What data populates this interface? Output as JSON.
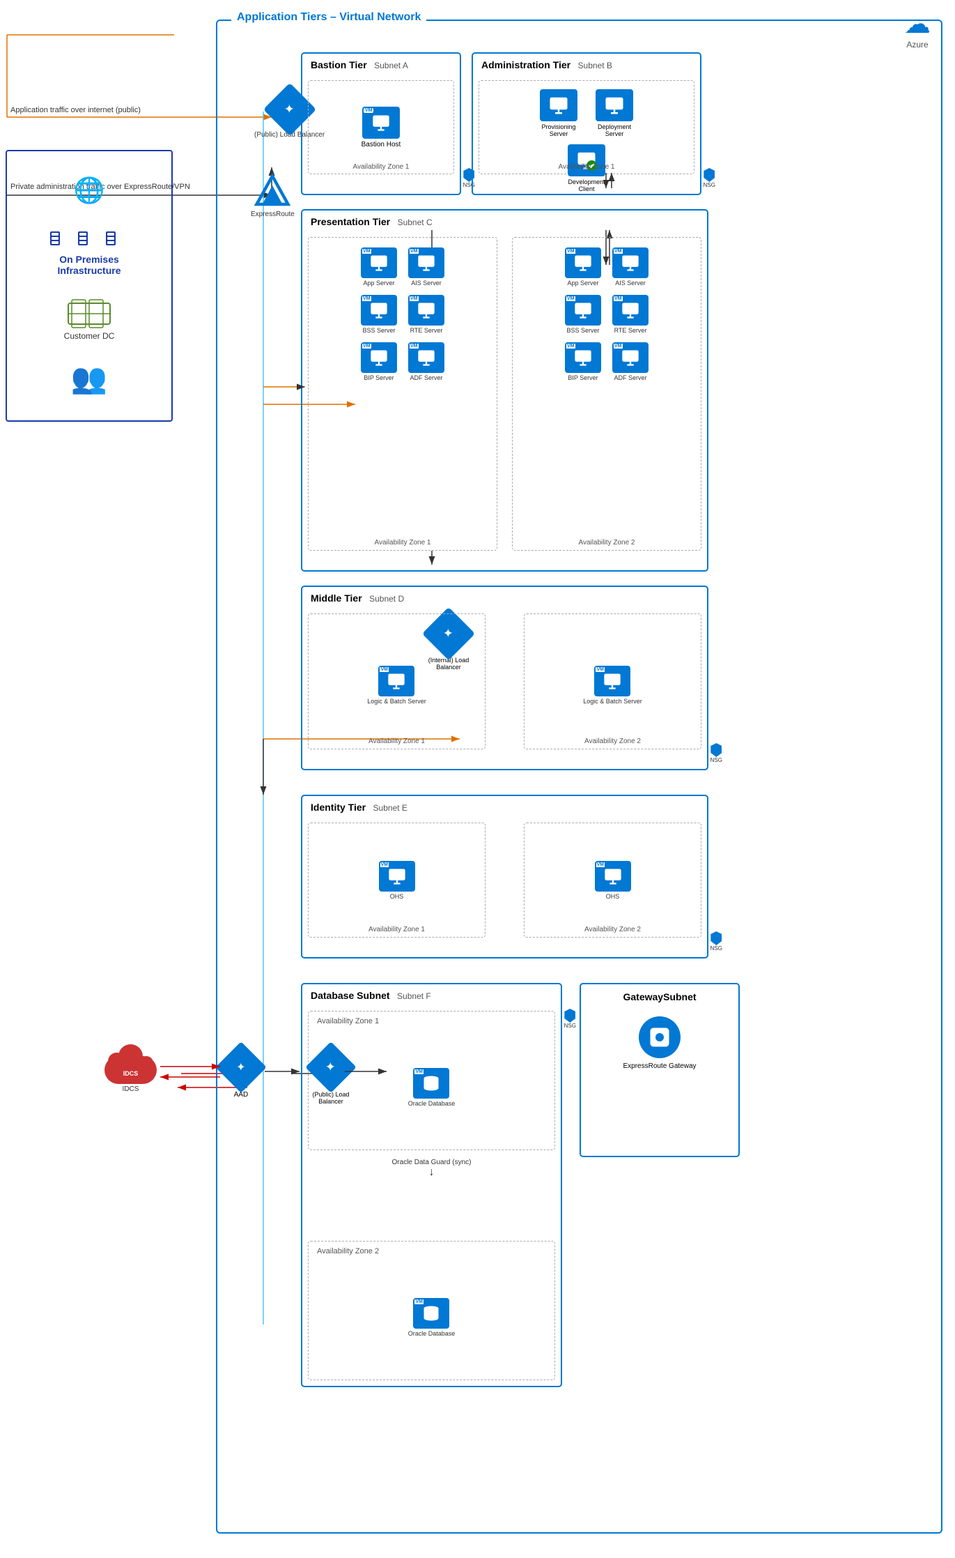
{
  "azure_label": "Azure",
  "vnet_title": "Application Tiers – Virtual Network",
  "on_prem": {
    "title": "On Premises\nInfrastructure",
    "customer_dc": "Customer DC"
  },
  "bastion_tier": {
    "title": "Bastion Tier",
    "subnet": "Subnet A",
    "bastion_host": "Bastion Host",
    "az_label": "Availability Zone 1"
  },
  "admin_tier": {
    "title": "Administration Tier",
    "subnet": "Subnet B",
    "provisioning_server": "Provisioning\nServer",
    "deployment_server": "Deployment\nServer",
    "development_client": "Development\nClient",
    "az_label": "Availability Zone 1"
  },
  "presentation_tier": {
    "title": "Presentation Tier",
    "subnet": "Subnet C",
    "az1_label": "Availability Zone 1",
    "az2_label": "Availability Zone 2",
    "servers_az1": [
      {
        "name": "App Server"
      },
      {
        "name": "AIS Server"
      },
      {
        "name": "BSS Server"
      },
      {
        "name": "RTE Server"
      },
      {
        "name": "BIP Server"
      },
      {
        "name": "ADF Server"
      }
    ],
    "servers_az2": [
      {
        "name": "App Server"
      },
      {
        "name": "AIS Server"
      },
      {
        "name": "BSS Server"
      },
      {
        "name": "RTE Server"
      },
      {
        "name": "BIP Server"
      },
      {
        "name": "ADF Server"
      }
    ]
  },
  "middle_tier": {
    "title": "Middle Tier",
    "subnet": "Subnet D",
    "lb_label": "(Internal)\nLoad Balancer",
    "az1_label": "Availability Zone 1",
    "az2_label": "Availability Zone 2",
    "server_az1": "Logic & Batch Server",
    "server_az2": "Logic & Batch Server"
  },
  "identity_tier": {
    "title": "Identity Tier",
    "subnet": "Subnet E",
    "lb_label": "(Public)\nLoad Balancer",
    "az1_label": "Availability Zone 1",
    "az2_label": "Availability Zone 2",
    "server_az1": "OHS",
    "server_az2": "OHS",
    "idcs_label": "IDCS",
    "aad_label": "AAD"
  },
  "database_tier": {
    "title": "Database Subnet",
    "subnet": "Subnet F",
    "az1_label": "Availability Zone 1",
    "az2_label": "Availability Zone 2",
    "db1": "Oracle Database",
    "db2": "Oracle Database",
    "sync_label": "Oracle Data\nGuard (sync)"
  },
  "gateway_subnet": {
    "title": "GatewaySubnet",
    "er_gateway": "ExpressRoute Gateway"
  },
  "public_lb": {
    "label": "(Public)\nLoad Balancer"
  },
  "expressroute": {
    "label": "ExpressRoute"
  },
  "traffic_labels": {
    "app_traffic": "Application traffic over internet (public)",
    "private_admin": "Private administration traffic over ExpressRoute/VPN"
  }
}
